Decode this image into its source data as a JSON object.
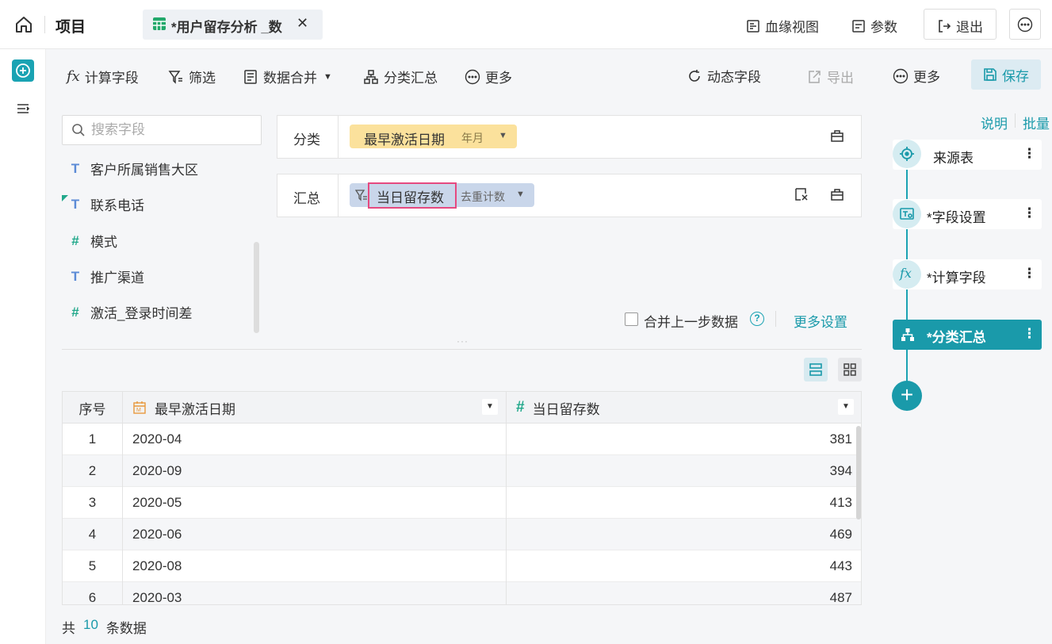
{
  "topbar": {
    "title": "项目",
    "tab_label": "*用户留存分析 _数",
    "close": "✕",
    "lineage": "血缘视图",
    "params": "参数",
    "exit": "退出",
    "more": "⋯"
  },
  "toolbar": {
    "calc_field": "计算字段",
    "filter": "筛选",
    "merge": "数据合并",
    "group_summary": "分类汇总",
    "more": "更多",
    "dynamic_field": "动态字段",
    "export": "导出",
    "more_right": "更多",
    "save": "保存"
  },
  "fields": {
    "search_placeholder": "搜索字段",
    "items": [
      {
        "type": "T",
        "label": "客户所属销售大区"
      },
      {
        "type": "T",
        "label": "联系电话"
      },
      {
        "type": "#",
        "label": "模式"
      },
      {
        "type": "T",
        "label": "推广渠道"
      },
      {
        "type": "#",
        "label": "激活_登录时间差"
      }
    ]
  },
  "config": {
    "group_label": "分类",
    "group_field": "最早激活日期",
    "group_granularity": "年月",
    "summary_label": "汇总",
    "summary_field": "当日留存数",
    "summary_method": "去重计数",
    "merge_prev": "合并上一步数据",
    "more_settings": "更多设置"
  },
  "table": {
    "headers": [
      "序号",
      "最早激活日期",
      "当日留存数"
    ],
    "rows": [
      {
        "idx": "1",
        "date": "2020-04",
        "value": "381"
      },
      {
        "idx": "2",
        "date": "2020-09",
        "value": "394"
      },
      {
        "idx": "3",
        "date": "2020-05",
        "value": "413"
      },
      {
        "idx": "4",
        "date": "2020-06",
        "value": "469"
      },
      {
        "idx": "5",
        "date": "2020-08",
        "value": "443"
      },
      {
        "idx": "6",
        "date": "2020-03",
        "value": "487"
      }
    ]
  },
  "footer": {
    "prefix": "共",
    "count": "10",
    "suffix": "条数据"
  },
  "pipeline": {
    "explain": "说明",
    "batch": "批量",
    "steps": [
      {
        "label": "来源表",
        "icon": "target-icon"
      },
      {
        "label": "*字段设置",
        "icon": "field-settings-icon"
      },
      {
        "label": "*计算字段",
        "icon": "fx-icon"
      },
      {
        "label": "*分类汇总",
        "icon": "hierarchy-icon"
      }
    ],
    "menu": "⋮",
    "add": "+"
  },
  "colors": {
    "accent": "#1a9aaa",
    "date_tag": "#fbe19c",
    "summary_tag": "#c9d6ea",
    "highlight": "#e64980"
  }
}
